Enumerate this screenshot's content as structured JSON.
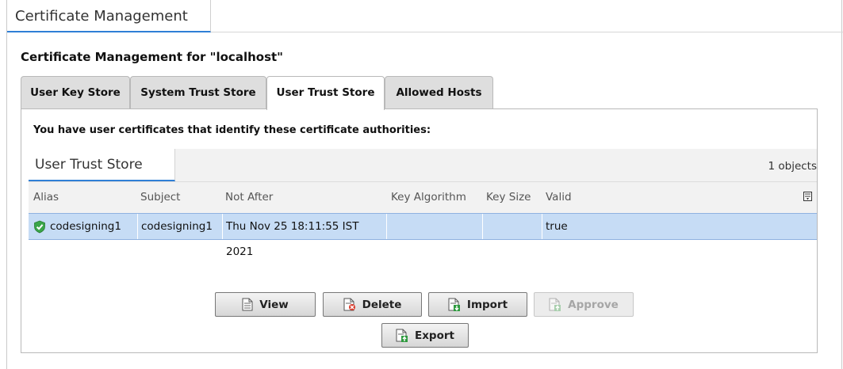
{
  "view_tab": {
    "label": "Certificate Management"
  },
  "page_title": "Certificate Management for \"localhost\"",
  "tabs": [
    {
      "label": "User Key Store"
    },
    {
      "label": "System Trust Store"
    },
    {
      "label": "User Trust Store",
      "active": true
    },
    {
      "label": "Allowed Hosts"
    }
  ],
  "description": "You have user certificates that identify these certificate authorities:",
  "table": {
    "title": "User Trust Store",
    "object_count": "1 objects",
    "columns": [
      "Alias",
      "Subject",
      "Not After",
      "Key Algorithm",
      "Key Size",
      "Valid"
    ],
    "rows": [
      {
        "alias": "codesigning1",
        "subject": "codesigning1",
        "not_after": "Thu Nov 25 18:11:55 IST 2021",
        "key_algorithm": "",
        "key_size": "",
        "valid": "true",
        "icon": "green-shield-check-icon"
      }
    ]
  },
  "buttons": {
    "view": "View",
    "delete": "Delete",
    "import": "Import",
    "approve": "Approve",
    "export": "Export"
  },
  "colors": {
    "accent_blue": "#2f7fd6",
    "selection": "#c6dcf5",
    "valid_green": "#3aa548"
  }
}
